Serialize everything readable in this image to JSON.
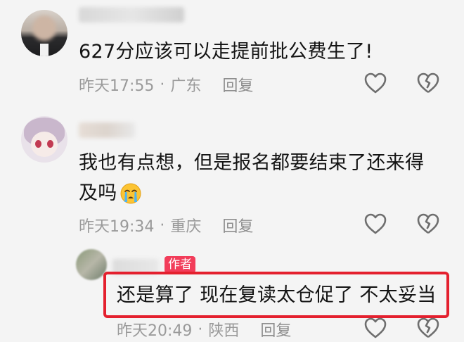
{
  "comments": [
    {
      "text": "627分应该可以走提前批公费生了!",
      "time": "昨天17:55",
      "sep": "·",
      "location": "广东",
      "reply": "回复",
      "like_icon": "heart-outline-icon",
      "dislike_icon": "broken-heart-icon"
    },
    {
      "text_line1": "我也有点想，但是报名都要结束了还来得",
      "text_line2": "及吗",
      "emoji": "crying-face-emoji",
      "time": "昨天19:34",
      "sep": "·",
      "location": "重庆",
      "reply": "回复"
    },
    {
      "badge": "作者",
      "text": "还是算了 现在复读太仓促了 不太妥当",
      "time": "昨天20:49",
      "sep": "·",
      "location": "陕西",
      "reply": "回复"
    }
  ],
  "colors": {
    "background": "#f4f4f4",
    "meta_text": "#9a9a9a",
    "author_badge": "#f23d5a",
    "highlight_border": "#e4202e"
  }
}
